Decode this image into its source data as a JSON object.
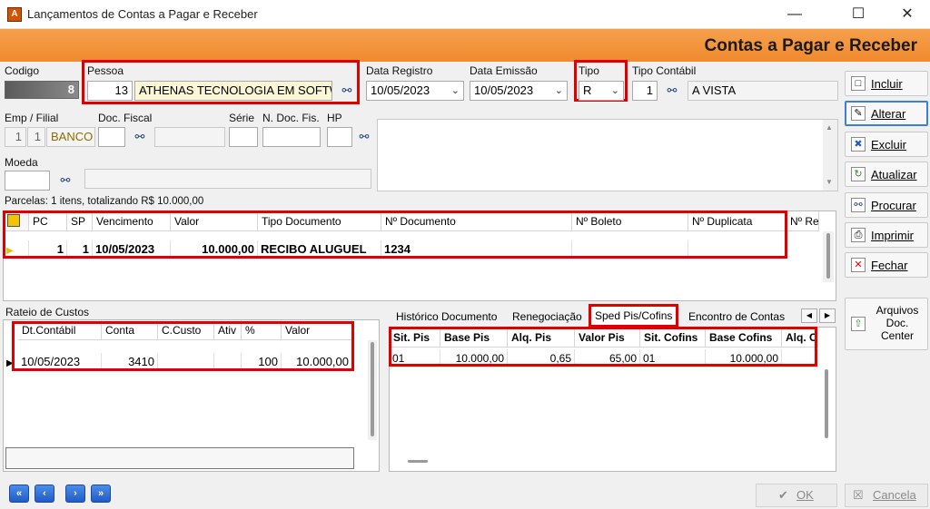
{
  "window": {
    "title": "Lançamentos de Contas a Pagar e Receber",
    "minimize": "—",
    "maximize": "☐",
    "close": "✕"
  },
  "header": {
    "title": "Contas a Pagar e Receber"
  },
  "form": {
    "codigo_label": "Codigo",
    "codigo_value": "8",
    "pessoa_label": "Pessoa",
    "pessoa_code": "13",
    "pessoa_name": "ATHENAS TECNOLOGIA EM SOFTWA",
    "data_registro_label": "Data Registro",
    "data_registro_value": "10/05/2023",
    "data_emissao_label": "Data Emissão",
    "data_emissao_value": "10/05/2023",
    "tipo_label": "Tipo",
    "tipo_value": "R",
    "tipo_contabil_label": "Tipo Contábil",
    "tipo_contabil_code": "1",
    "tipo_contabil_name": "A VISTA",
    "emp_filial_label": "Emp / Filial",
    "emp_value": "1",
    "filial_value": "1",
    "banco_value": "BANCO D",
    "doc_fiscal_label": "Doc. Fiscal",
    "serie_label": "Série",
    "n_doc_fis_label": "N. Doc. Fis.",
    "hp_label": "HP",
    "moeda_label": "Moeda"
  },
  "parcelas": {
    "summary": "Parcelas: 1 itens, totalizando R$ 10.000,00",
    "headers": [
      "PC",
      "SP",
      "Vencimento",
      "Valor",
      "Tipo Documento",
      "Nº Documento",
      "Nº Boleto",
      "Nº Duplicata",
      "Nº Re"
    ],
    "row": {
      "pc": "1",
      "sp": "1",
      "vencimento": "10/05/2023",
      "valor": "10.000,00",
      "tipo_documento": "RECIBO ALUGUEL",
      "n_documento": "1234",
      "n_boleto": "",
      "n_duplicata": ""
    }
  },
  "rateio": {
    "title": "Rateio de Custos",
    "headers": [
      "Dt.Contábil",
      "Conta",
      "C.Custo",
      "Ativ",
      "%",
      "Valor"
    ],
    "row": {
      "dt_contabil": "10/05/2023",
      "conta": "3410",
      "c_custo": "",
      "ativ": "",
      "percent": "100",
      "valor": "10.000,00"
    }
  },
  "tabs": [
    {
      "label": "Histórico Documento"
    },
    {
      "label": "Renegociação"
    },
    {
      "label": "Sped Pis/Cofins"
    },
    {
      "label": "Encontro de Contas"
    }
  ],
  "sped": {
    "headers": [
      "Sit. Pis",
      "Base Pis",
      "Alq. Pis",
      "Valor Pis",
      "Sit. Cofins",
      "Base Cofins",
      "Alq. C"
    ],
    "row": {
      "sit_pis": "01",
      "base_pis": "10.000,00",
      "alq_pis": "0,65",
      "valor_pis": "65,00",
      "sit_cofins": "01",
      "base_cofins": "10.000,00",
      "alq_cofins": ""
    }
  },
  "side_buttons": {
    "incluir": "Incluir",
    "alterar": "Alterar",
    "excluir": "Excluir",
    "atualizar": "Atualizar",
    "procurar": "Procurar",
    "imprimir": "Imprimir",
    "fechar": "Fechar",
    "arquivos": "Arquivos Doc. Center"
  },
  "footer": {
    "ok": "OK",
    "cancela": "Cancela"
  },
  "colors": {
    "header_orange": "#f08a2d",
    "highlight_red": "#e00000",
    "nav_blue": "#1f5dc7",
    "pessoa_name_bg": "#fbf7d6"
  }
}
